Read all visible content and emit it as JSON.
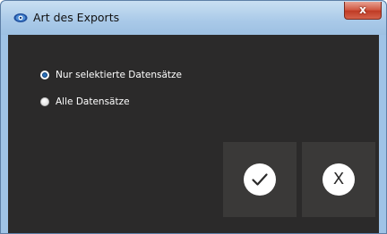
{
  "window": {
    "title": "Art des Exports",
    "close_label": "x"
  },
  "options": [
    {
      "label": "Nur selektierte Datensätze",
      "selected": true
    },
    {
      "label": "Alle Datensätze",
      "selected": false
    }
  ],
  "buttons": {
    "confirm_icon": "checkmark-icon",
    "cancel_label": "X"
  },
  "colors": {
    "content_background": "#2b2a2a",
    "button_background": "#3a3938",
    "radio_accent": "#2b6fb7"
  }
}
